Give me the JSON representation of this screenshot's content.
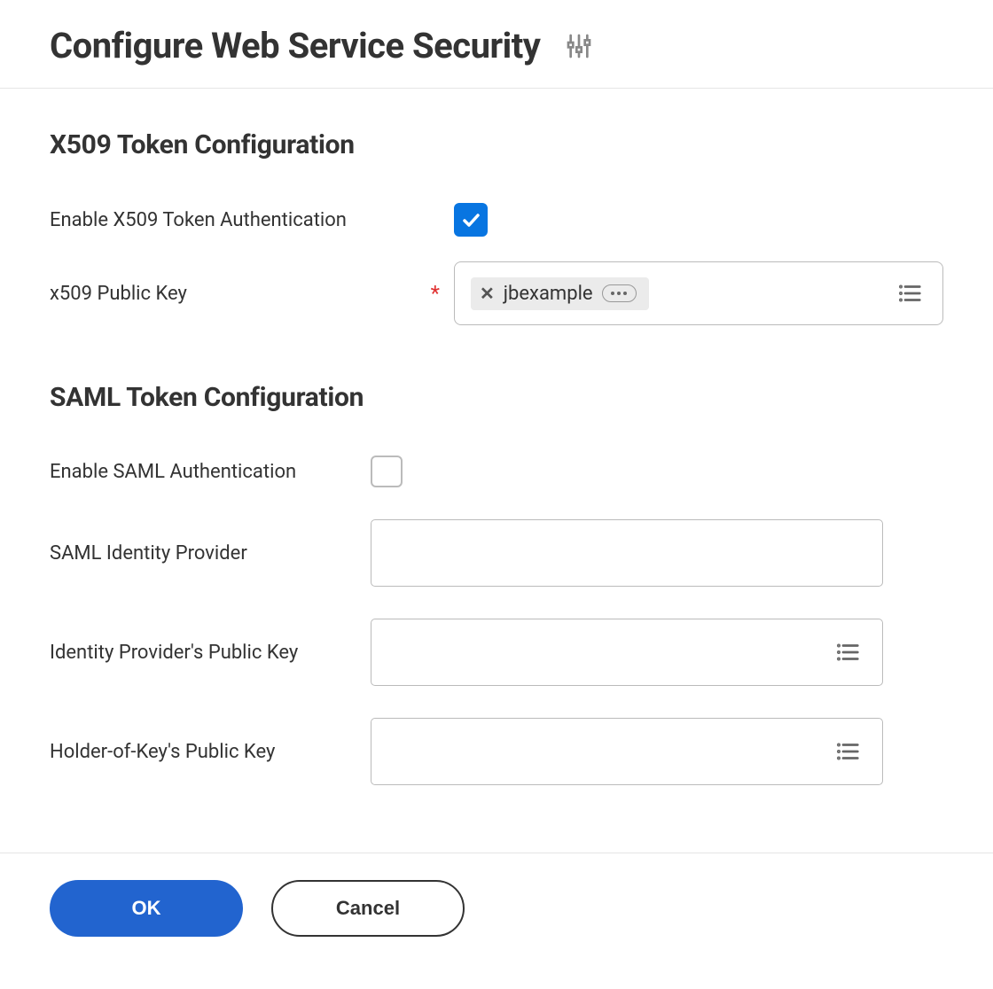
{
  "header": {
    "title": "Configure Web Service Security"
  },
  "x509": {
    "section_title": "X509 Token Configuration",
    "enable_label": "Enable X509 Token Authentication",
    "enable_checked": true,
    "public_key_label": "x509 Public Key",
    "public_key_required": true,
    "public_key_chip": "jbexample"
  },
  "saml": {
    "section_title": "SAML Token Configuration",
    "enable_label": "Enable SAML Authentication",
    "enable_checked": false,
    "idp_label": "SAML Identity Provider",
    "idp_value": "",
    "idp_key_label": "Identity Provider's Public Key",
    "hok_key_label": "Holder-of-Key's Public Key"
  },
  "footer": {
    "ok_label": "OK",
    "cancel_label": "Cancel"
  }
}
